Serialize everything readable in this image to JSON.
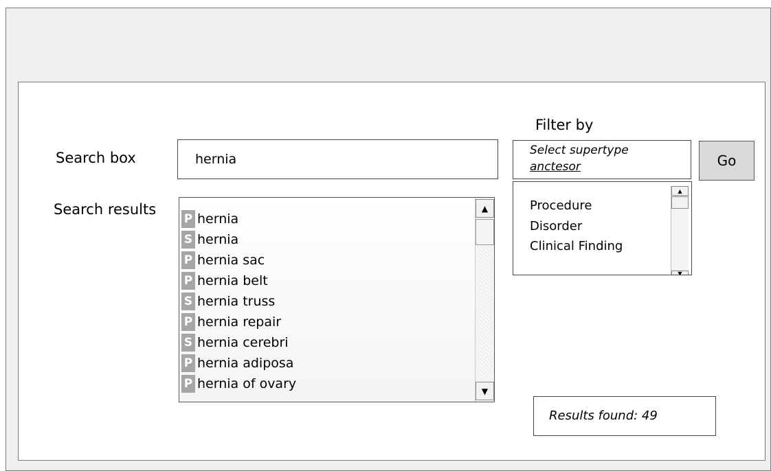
{
  "search": {
    "label": "Search box",
    "value": "hernia"
  },
  "results": {
    "label": "Search results",
    "items": [
      {
        "badge": "P",
        "text": "hernia"
      },
      {
        "badge": "S",
        "text": "hernia"
      },
      {
        "badge": "P",
        "text": "hernia sac"
      },
      {
        "badge": "P",
        "text": "hernia belt"
      },
      {
        "badge": "S",
        "text": "hernia truss"
      },
      {
        "badge": "P",
        "text": "hernia repair"
      },
      {
        "badge": "S",
        "text": "hernia cerebri"
      },
      {
        "badge": "P",
        "text": "hernia adiposa"
      },
      {
        "badge": "P",
        "text": "hernia of ovary"
      }
    ],
    "count_text": "Results found: 49"
  },
  "filter": {
    "label": "Filter by",
    "select_line1": "Select supertype",
    "select_line2": "anctesor",
    "options": [
      "Procedure",
      "Disorder",
      "Clinical Finding"
    ],
    "go_label": "Go"
  },
  "icons": {
    "scroll_up": "arrow-up-icon",
    "scroll_down": "arrow-down-icon"
  },
  "colors": {
    "badge_bg": "#a6a6a6",
    "go_button_bg": "#d9d9d9",
    "window_bg": "#efefef"
  }
}
